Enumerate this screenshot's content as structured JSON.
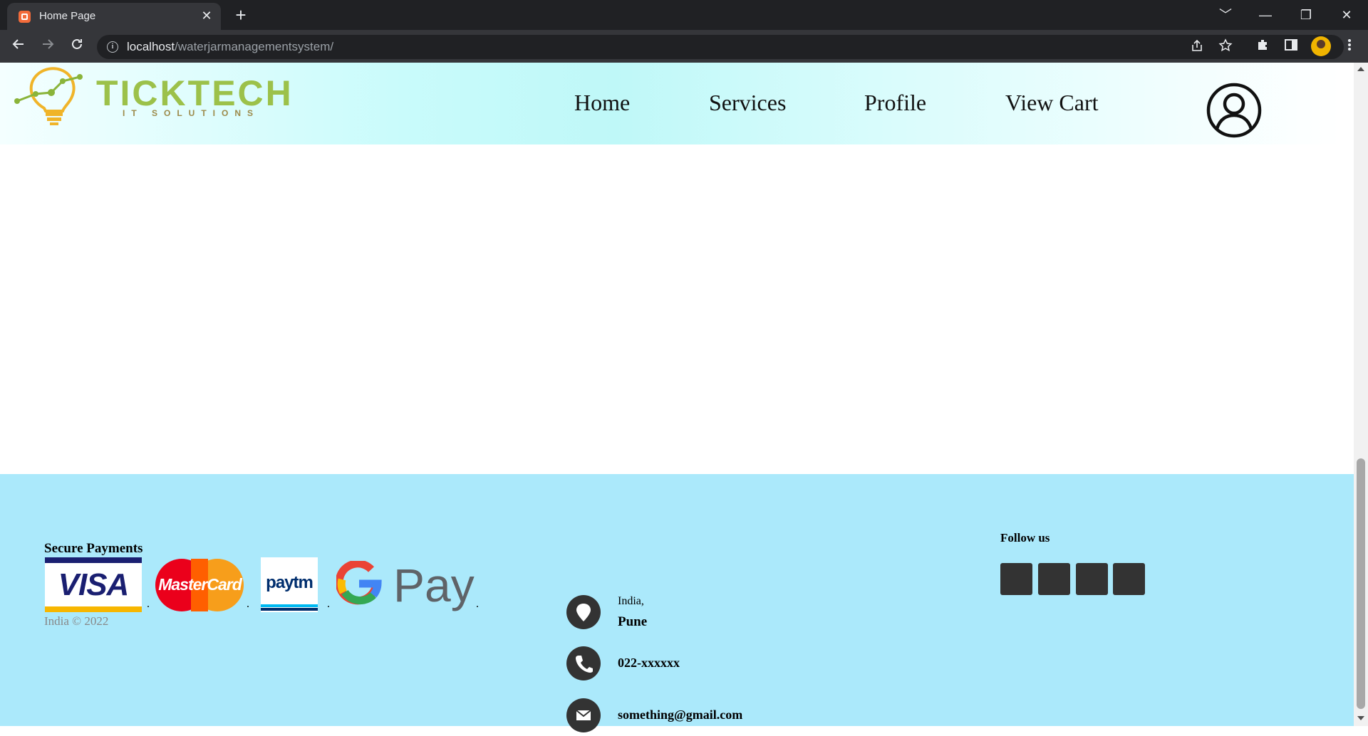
{
  "browser": {
    "tab_title": "Home Page",
    "tab_close": "✕",
    "new_tab": "+",
    "url_host": "localhost",
    "url_path": "/waterjarmanagementsystem/",
    "window_controls": [
      "﹀",
      "—",
      "❐",
      "✕"
    ]
  },
  "header": {
    "logo_text": "TICKTECH",
    "logo_subtext": "IT SOLUTIONS",
    "nav": {
      "home": "Home",
      "services": "Services",
      "profile": "Profile",
      "view_cart": "View Cart"
    }
  },
  "footer": {
    "payments_title": "Secure Payments",
    "payment_methods": {
      "visa": "VISA",
      "mastercard": "MasterCard",
      "paytm": "paytm",
      "gpay": "Pay"
    },
    "payment_separator": ".",
    "copyright": "India © 2022",
    "contact": {
      "country": "India,",
      "city": "Pune",
      "phone": "022-xxxxxx",
      "email": "something@gmail.com"
    },
    "follow_title": "Follow us"
  },
  "colors": {
    "footer_bg": "#abe9fb",
    "header_accent": "#bff8f8",
    "logo_green": "#9cc14a",
    "icon_dark": "#333333"
  },
  "icons": [
    "close-icon",
    "plus-icon",
    "back-icon",
    "forward-icon",
    "reload-icon",
    "info-icon",
    "share-icon",
    "star-icon",
    "extensions-icon",
    "sidebar-icon",
    "menu-icon",
    "user-icon",
    "location-icon",
    "phone-icon",
    "mail-icon"
  ]
}
